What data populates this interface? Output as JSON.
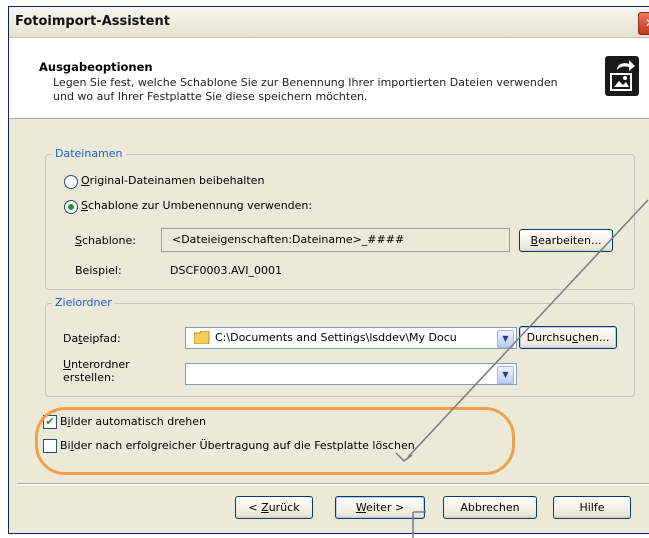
{
  "window": {
    "title": "Fotoimport-Assistent",
    "close_glyph": "✕"
  },
  "header": {
    "title": "Ausgabeoptionen",
    "description": "Legen Sie fest, welche Schablone Sie zur Benennung Ihrer importierten Dateien verwenden und wo auf Ihrer Festplatte Sie diese speichern möchten.",
    "icon": "photo-import-icon"
  },
  "filenames_group": {
    "legend": "Dateinamen",
    "option_keep": {
      "prefix": "O",
      "rest": "riginal-Dateinamen beibehalten",
      "selected": false
    },
    "option_template": {
      "prefix": "S",
      "rest": "chablone zur Umbenennung verwenden:",
      "selected": true
    },
    "template_label": {
      "prefix": "S",
      "rest": "chablone:"
    },
    "template_value": "<Dateieigenschaften:Dateiname>_####",
    "edit_button": {
      "prefix": "B",
      "rest": "earbeiten..."
    },
    "example_label": "Beispiel:",
    "example_value": "DSCF0003.AVI_0001"
  },
  "target_group": {
    "legend": "Zielordner",
    "path_label": {
      "pre": "Da",
      "u": "t",
      "post": "eipfad:"
    },
    "path_value": "C:\\Documents and Settings\\lsddev\\My Docu",
    "browse_button": {
      "pre": "Durchsu",
      "u": "c",
      "post": "hen..."
    },
    "subfolder_label_1": {
      "prefix": "U",
      "rest": "nterordner"
    },
    "subfolder_label_2": "erstellen:",
    "subfolder_value": ""
  },
  "options": {
    "auto_rotate": {
      "pre": "B",
      "u": "i",
      "post": "lder automatisch drehen",
      "checked": true
    },
    "delete_after": {
      "pre": "Bi",
      "u": "l",
      "post": "der nach erfolgreicher Übertragung auf die Festplatte löschen",
      "checked": false
    }
  },
  "footer": {
    "back": {
      "pre": "< ",
      "u": "Z",
      "post": "urück"
    },
    "next": {
      "u": "W",
      "post": "eiter >"
    },
    "cancel": "Abbrechen",
    "help": "Hilfe"
  },
  "colors": {
    "legend": "#1c5fcc",
    "highlight": "#f0a04b",
    "dialog": "#ece9d8"
  }
}
